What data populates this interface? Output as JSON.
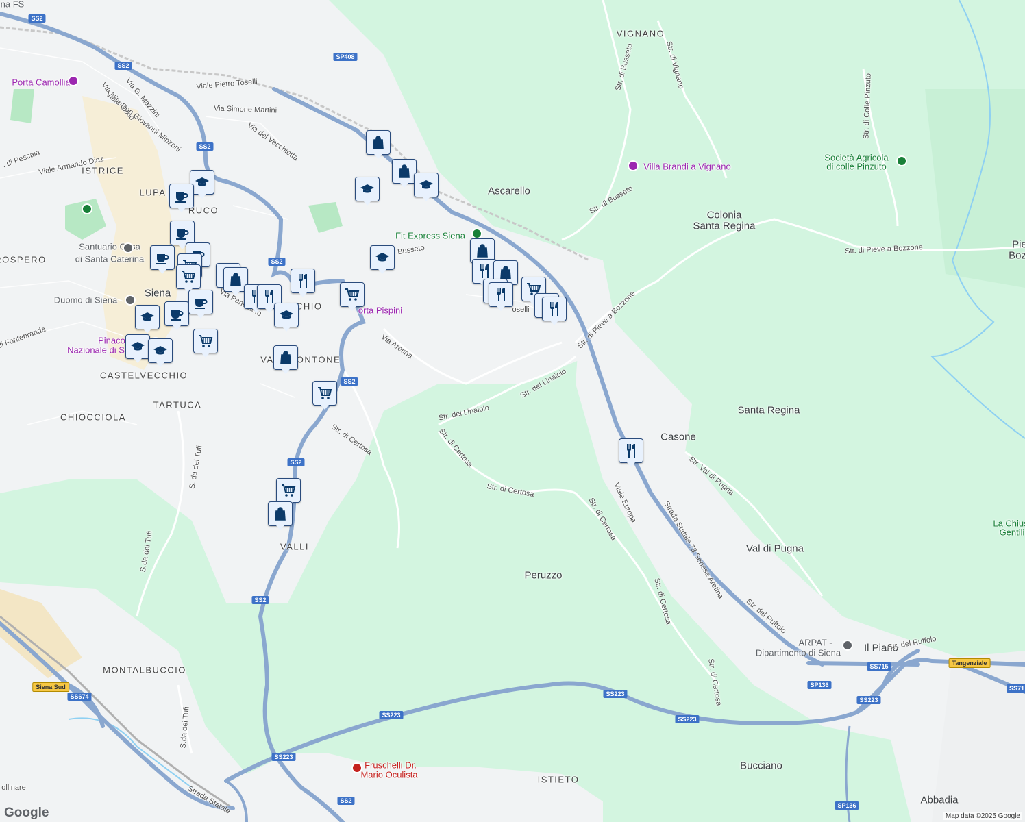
{
  "map": {
    "places": [
      {
        "label": "Siena",
        "kind": "place"
      },
      {
        "label": "Ascarello",
        "kind": "place"
      },
      {
        "label": "Colonia",
        "kind": "place"
      },
      {
        "label": "Santa Regina",
        "kind": "place"
      },
      {
        "label": "Santa Regina",
        "kind": "place"
      },
      {
        "label": "Casone",
        "kind": "place"
      },
      {
        "label": "Val di Pugna",
        "kind": "place"
      },
      {
        "label": "Peruzzo",
        "kind": "place"
      },
      {
        "label": "Bucciano",
        "kind": "place"
      },
      {
        "label": "Abbadia",
        "kind": "place"
      },
      {
        "label": "Il Piano",
        "kind": "place"
      },
      {
        "label": "Pie",
        "kind": "place"
      },
      {
        "label": "Boz",
        "kind": "place"
      },
      {
        "label": "VIGNANO",
        "kind": "hood"
      },
      {
        "label": "ISTRICE",
        "kind": "hood"
      },
      {
        "label": "LUPA",
        "kind": "hood"
      },
      {
        "label": "RUCO",
        "kind": "hood"
      },
      {
        "label": "ROSPERO",
        "kind": "hood"
      },
      {
        "label": "OCCHIO",
        "kind": "hood"
      },
      {
        "label": "VA",
        "kind": "hood"
      },
      {
        "label": "ONTONE",
        "kind": "hood"
      },
      {
        "label": "CASTELVECCHIO",
        "kind": "hood"
      },
      {
        "label": "TARTUCA",
        "kind": "hood"
      },
      {
        "label": "CHIOCCIOLA",
        "kind": "hood"
      },
      {
        "label": "VALLI",
        "kind": "hood"
      },
      {
        "label": "MONTALBUCCIO",
        "kind": "hood"
      },
      {
        "label": "ISTIETO",
        "kind": "hood"
      }
    ],
    "streets": [
      {
        "label": "Viale Pietro Toselli"
      },
      {
        "label": "Via Simone Martini"
      },
      {
        "label": "Via del Vecchietta"
      },
      {
        "label": "Via G. Mazzini"
      },
      {
        "label": "Via Nino Bixio"
      },
      {
        "label": "Viale Don Giovanni Minzoni"
      },
      {
        "label": "Viale Armando Diaz"
      },
      {
        "label": ". di Pescaia"
      },
      {
        "label": "Via Aretina"
      },
      {
        "label": "Str. del Linaiolo"
      },
      {
        "label": "Str. del Linaiolo"
      },
      {
        "label": "Str. di Certosa"
      },
      {
        "label": "Str. di Certosa"
      },
      {
        "label": "Str. di Certosa"
      },
      {
        "label": "Str. di Certosa"
      },
      {
        "label": "Str. di Certosa"
      },
      {
        "label": "Str. di Certosa"
      },
      {
        "label": "Str. di Pieve a Bozzone"
      },
      {
        "label": "Str. di Pieve a Bozzone"
      },
      {
        "label": "Str. di Busseto"
      },
      {
        "label": "Str. di Busseto"
      },
      {
        "label": "Str. di Vignano"
      },
      {
        "label": "Str. di Colle Pinzuto"
      },
      {
        "label": "Str. Val di Pugna"
      },
      {
        "label": "Viale Europa"
      },
      {
        "label": "Strada Statale 73 Senese Aretina"
      },
      {
        "label": "Str. del Ruffolo"
      },
      {
        "label": "Str. del Ruffolo"
      },
      {
        "label": "S. da dei Tufi"
      },
      {
        "label": "S.da dei Tufi"
      },
      {
        "label": "S.da dei Tufi"
      },
      {
        "label": "Via Pantaneto"
      },
      {
        "label": "ia di Fontebranda"
      },
      {
        "label": "Strada Statale"
      },
      {
        "label": "ollinare"
      },
      {
        "label": "Busseto"
      },
      {
        "label": "oselli"
      }
    ],
    "pois": [
      {
        "label": "Porta Camollia",
        "color": "purple"
      },
      {
        "label": "Villa Brandi a Vignano",
        "color": "purple"
      },
      {
        "label": "Società Agricola",
        "color": "green"
      },
      {
        "label": "di colle Pinzuto",
        "color": "green"
      },
      {
        "label": "Fit Express Siena",
        "color": "green"
      },
      {
        "label": "Santuario Casa",
        "color": "grey"
      },
      {
        "label": "di Santa Caterina",
        "color": "grey"
      },
      {
        "label": "Duomo di Siena",
        "color": "grey"
      },
      {
        "label": "Pinaco",
        "color": "purple"
      },
      {
        "label": "Nazionale di S",
        "color": "purple"
      },
      {
        "label": "orta Pispini",
        "color": "purple"
      },
      {
        "label": "ARPAT -",
        "color": "grey"
      },
      {
        "label": "Dipartimento di Siena",
        "color": "grey"
      },
      {
        "label": "Fruschelli Dr.",
        "color": "red"
      },
      {
        "label": "Mario Oculista",
        "color": "red"
      },
      {
        "label": "La Chius",
        "color": "green"
      },
      {
        "label": "Gentili",
        "color": "green"
      },
      {
        "label": "na FS",
        "color": "grey"
      }
    ],
    "shields": [
      {
        "label": "SS2",
        "style": "blue"
      },
      {
        "label": "SS2",
        "style": "blue"
      },
      {
        "label": "SS2",
        "style": "blue"
      },
      {
        "label": "SS2",
        "style": "blue"
      },
      {
        "label": "SS2",
        "style": "blue"
      },
      {
        "label": "SS2",
        "style": "blue"
      },
      {
        "label": "SS2",
        "style": "blue"
      },
      {
        "label": "SS2",
        "style": "blue"
      },
      {
        "label": "SP408",
        "style": "blue"
      },
      {
        "label": "SS223",
        "style": "blue"
      },
      {
        "label": "SS223",
        "style": "blue"
      },
      {
        "label": "SS223",
        "style": "blue"
      },
      {
        "label": "SS223",
        "style": "blue"
      },
      {
        "label": "SS223",
        "style": "blue"
      },
      {
        "label": "SS715",
        "style": "blue"
      },
      {
        "label": "SS71",
        "style": "blue"
      },
      {
        "label": "SP136",
        "style": "blue"
      },
      {
        "label": "SP136",
        "style": "blue"
      },
      {
        "label": "SS674",
        "style": "blue"
      },
      {
        "label": "Siena Sud",
        "style": "yellow"
      },
      {
        "label": "Tangenziale",
        "style": "yellow"
      }
    ],
    "pins": [
      {
        "icon": "bag-icon"
      },
      {
        "icon": "bag-icon"
      },
      {
        "icon": "school-icon"
      },
      {
        "icon": "school-icon"
      },
      {
        "icon": "school-icon"
      },
      {
        "icon": "coffee-icon"
      },
      {
        "icon": "coffee-icon"
      },
      {
        "icon": "coffee-icon"
      },
      {
        "icon": "coffee-icon"
      },
      {
        "icon": "cart-icon"
      },
      {
        "icon": "cart-icon"
      },
      {
        "icon": "bag-icon"
      },
      {
        "icon": "bag-icon"
      },
      {
        "icon": "restaurant-icon"
      },
      {
        "icon": "restaurant-icon"
      },
      {
        "icon": "restaurant-icon"
      },
      {
        "icon": "school-icon"
      },
      {
        "icon": "school-icon"
      },
      {
        "icon": "coffee-icon"
      },
      {
        "icon": "coffee-icon"
      },
      {
        "icon": "cart-icon"
      },
      {
        "icon": "school-icon"
      },
      {
        "icon": "school-icon"
      },
      {
        "icon": "bag-icon"
      },
      {
        "icon": "cart-icon"
      },
      {
        "icon": "school-icon"
      },
      {
        "icon": "cart-icon"
      },
      {
        "icon": "bag-icon"
      },
      {
        "icon": "restaurant-icon"
      },
      {
        "icon": "bag-icon"
      },
      {
        "icon": "restaurant-icon"
      },
      {
        "icon": "restaurant-icon"
      },
      {
        "icon": "cart-icon"
      },
      {
        "icon": "restaurant-icon"
      },
      {
        "icon": "restaurant-icon"
      },
      {
        "icon": "restaurant-icon"
      },
      {
        "icon": "cart-icon"
      },
      {
        "icon": "bag-icon"
      }
    ],
    "attribution": "Map data ©2025 Google",
    "logo": "Google"
  }
}
